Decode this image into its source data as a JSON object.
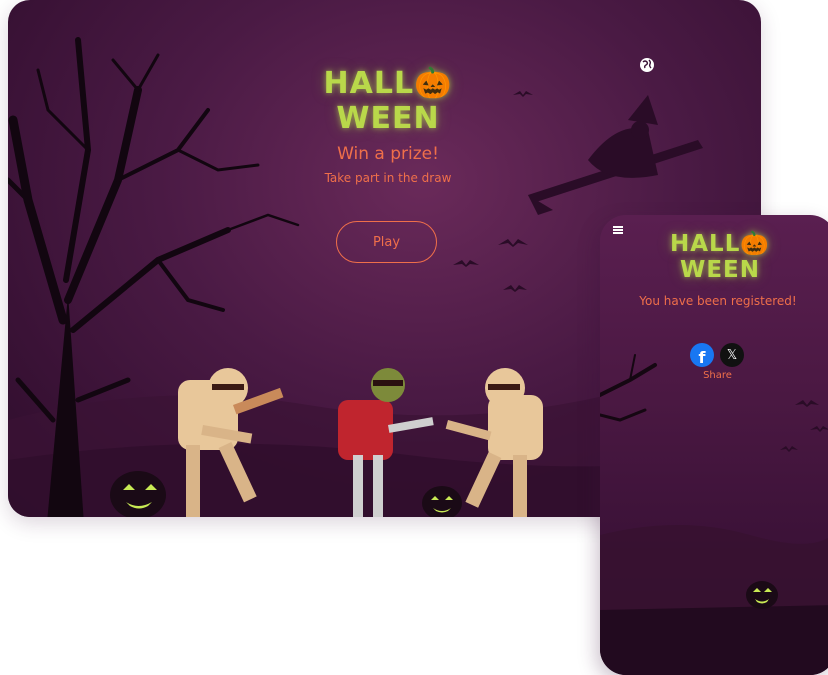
{
  "desktop": {
    "logo": "HALL🎃WEEN",
    "globe_icon": "globe-icon",
    "headline": "Win a prize!",
    "subline": "Take part in the draw",
    "play_label": "Play"
  },
  "mobile": {
    "menu_icon": "hamburger-menu-icon",
    "logo": "HALL🎃WEEN",
    "registered_text": "You have been registered!",
    "share": {
      "facebook_icon": "facebook-icon",
      "x_icon": "x-icon",
      "label": "Share"
    }
  },
  "colors": {
    "accent": "#ef6f4a",
    "logo_green": "#b9d84a",
    "background_purple": "#4a1a44"
  }
}
